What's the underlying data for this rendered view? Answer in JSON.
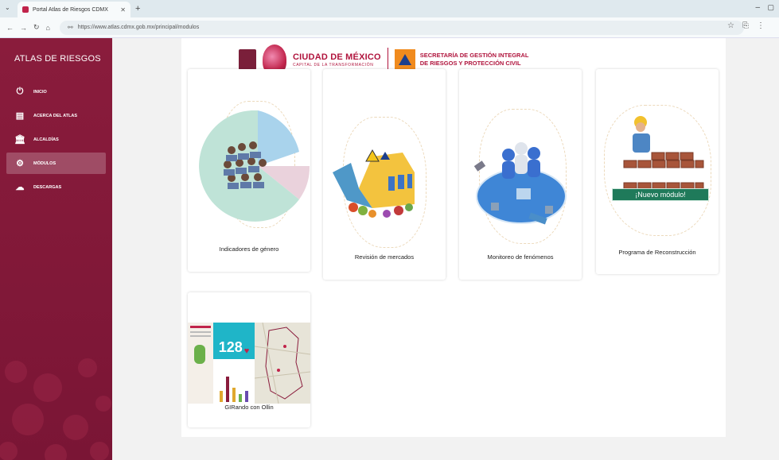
{
  "browser": {
    "tab_title": "Portal Atlas de Riesgos CDMX",
    "tab_close": "✕",
    "new_tab": "+",
    "url": "https://www.atlas.cdmx.gob.mx/principal/modulos"
  },
  "sidebar": {
    "title": "ATLAS DE RIESGOS",
    "items": [
      {
        "label": "INICIO",
        "icon": "power-icon"
      },
      {
        "label": "ACERCA DEL ATLAS",
        "icon": "info-panel-icon"
      },
      {
        "label": "ALCALDÍAS",
        "icon": "building-icon"
      },
      {
        "label": "MÓDULOS",
        "icon": "gear-icon",
        "active": true
      },
      {
        "label": "DESCARGAS",
        "icon": "cloud-download-icon"
      }
    ]
  },
  "header": {
    "brand_title": "CIUDAD DE MÉXICO",
    "brand_subtitle": "CAPITAL DE LA TRANSFORMACIÓN",
    "secretaria_line1": "SECRETARÍA DE GESTIÓN INTEGRAL",
    "secretaria_line2": "DE RIESGOS Y PROTECCIÓN CIVIL"
  },
  "modules": [
    {
      "label": "Indicadores de género"
    },
    {
      "label": "Revisión de mercados"
    },
    {
      "label": "Monitoreo de fenómenos"
    },
    {
      "label": "Programa de Reconstrucción",
      "badge": "¡Nuevo módulo!"
    },
    {
      "label": "GIRando con Ollin",
      "counter": "128"
    }
  ],
  "colors": {
    "brand": "#8a1c3c",
    "accent": "#b0143d",
    "badge": "#1f7a5a"
  }
}
